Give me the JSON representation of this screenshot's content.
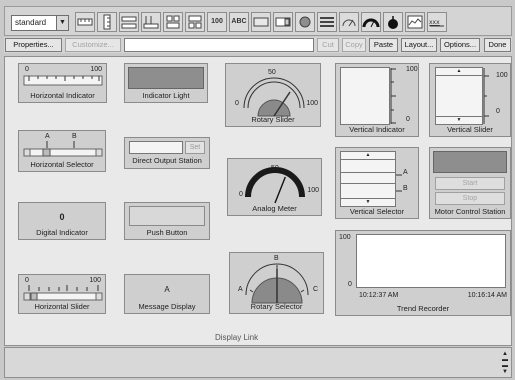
{
  "toolbar": {
    "page_select": "standard",
    "tools": [
      "horizontal-indicator-tool",
      "vertical-indicator-tool",
      "selector-tool-1",
      "selector-tool-2",
      "selector-tool-3",
      "selector-tool-4",
      "digital-indicator-tool",
      "message-display-tool",
      "push-button-tool",
      "direct-output-tool",
      "indicator-light-tool",
      "control-station-tool",
      "rotary-slider-tool",
      "analog-meter-tool",
      "rotary-selector-tool",
      "trend-recorder-tool",
      "display-link-tool"
    ],
    "tool_labels": {
      "digital": "100",
      "message": "ABC"
    }
  },
  "actions": {
    "properties": "Properties...",
    "customize": "Customize...",
    "cut": "Cut",
    "copy": "Copy",
    "paste": "Paste",
    "layout": "Layout...",
    "options": "Options...",
    "done": "Done"
  },
  "widgets": {
    "horizontal_indicator": {
      "caption": "Horizontal Indicator",
      "min": "0",
      "max": "100"
    },
    "indicator_light": {
      "caption": "Indicator Light"
    },
    "rotary_slider": {
      "caption": "Rotary Slider",
      "min": "0",
      "mid": "50",
      "max": "100"
    },
    "vertical_indicator": {
      "caption": "Vertical Indicator",
      "max": "100",
      "min": "0"
    },
    "vertical_slider": {
      "caption": "Vertical Slider",
      "max": "100",
      "min": "0"
    },
    "horizontal_selector": {
      "caption": "Horizontal Selector",
      "a": "A",
      "b": "B"
    },
    "direct_output": {
      "caption": "Direct Output Station",
      "set": "Set"
    },
    "analog_meter": {
      "caption": "Analog Meter",
      "min": "0",
      "mid": "50",
      "max": "100",
      "level": 0.62
    },
    "vertical_selector": {
      "caption": "Vertical Selector",
      "a": "A",
      "b": "B"
    },
    "motor_control": {
      "caption": "Motor Control Station",
      "start": "Start",
      "stop": "Stop"
    },
    "digital_indicator": {
      "caption": "Digital Indicator",
      "value": "0"
    },
    "push_button": {
      "caption": "Push Button"
    },
    "trend_recorder": {
      "caption": "Trend Recorder",
      "y_max": "100",
      "y_min": "0",
      "t_start": "10:12:37 AM",
      "t_end": "10:16:14 AM"
    },
    "horizontal_slider": {
      "caption": "Horizontal Slider",
      "min": "0",
      "max": "100"
    },
    "message_display": {
      "caption": "Message Display",
      "value": "A"
    },
    "rotary_selector": {
      "caption": "Rotary Selector",
      "a": "A",
      "b": "B",
      "c": "C"
    }
  },
  "display_link": "Display Link",
  "colors": {
    "canvas": "#e9e9e9",
    "widget": "#cfcfcf",
    "indicator_light": "#8e8e8e",
    "chrome": "#d4d4d4"
  }
}
